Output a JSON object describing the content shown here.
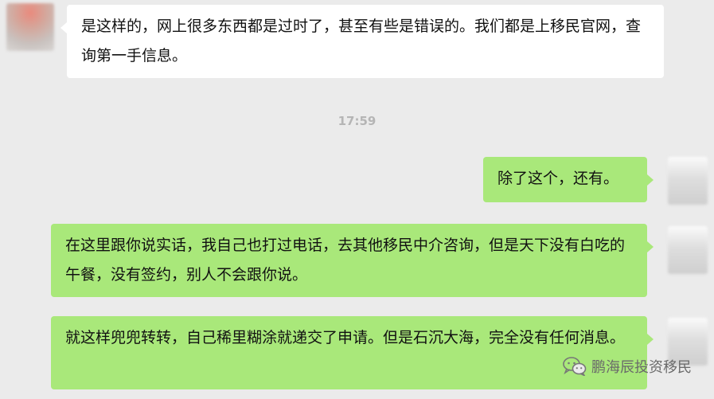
{
  "messages": [
    {
      "side": "left",
      "text": "是这样的，网上很多东西都是过时了，甚至有些是错误的。我们都是上移民官网，查询第一手信息。"
    },
    {
      "side": "right",
      "text": "除了这个，还有。"
    },
    {
      "side": "right",
      "text": "在这里跟你说实话，我自己也打过电话，去其他移民中介咨询，但是天下没有白吃的午餐，没有签约，别人不会跟你说。"
    },
    {
      "side": "right",
      "text": "就这样兜兜转转，自己稀里糊涂就递交了申请。但是石沉大海，完全没有任何消息。"
    }
  ],
  "timestamp": "17:59",
  "watermark": {
    "text": "鹏海辰投资移民",
    "icon": "wechat-icon"
  },
  "colors": {
    "background": "#ebebeb",
    "sent_bubble": "#a9e87a",
    "received_bubble": "#ffffff"
  }
}
